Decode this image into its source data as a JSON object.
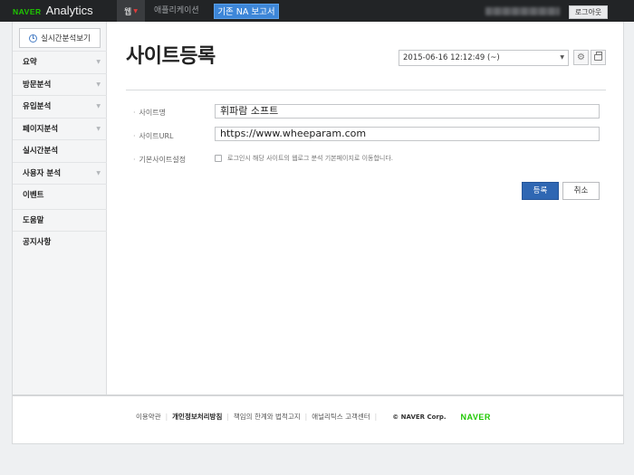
{
  "header": {
    "logo_naver": "NAVER",
    "logo_product": "Analytics",
    "nav_web": "웹",
    "nav_app": "애플리케이션",
    "nav_legacy": "기존 NA 보고서",
    "logout": "로그아웃",
    "brand_color": "#1ec800",
    "accent_color": "#3d86d8"
  },
  "sidebar": {
    "realtime_label": "실시간분석보기",
    "items": [
      {
        "label": "요약",
        "has_arrow": true
      },
      {
        "label": "방문분석",
        "has_arrow": true
      },
      {
        "label": "유입분석",
        "has_arrow": true
      },
      {
        "label": "페이지분석",
        "has_arrow": true
      },
      {
        "label": "실시간분석",
        "has_arrow": false
      },
      {
        "label": "사용자 분석",
        "has_arrow": true
      },
      {
        "label": "이벤트",
        "has_arrow": false
      },
      {
        "label": "도움말",
        "has_arrow": false
      },
      {
        "label": "공지사항",
        "has_arrow": false
      }
    ]
  },
  "main": {
    "title": "사이트등록",
    "date_value": "2015-06-16 12:12:49 (~)",
    "form": {
      "site_name_label": "사이트명",
      "site_name_value": "휘파람 소프트",
      "site_url_label": "사이트URL",
      "site_url_value": "https://www.wheeparam.com",
      "default_site_label": "기본사이트설정",
      "default_site_checkbox_text": "로그인시 해당 사이트의 웹로그 분석 기본페이지로 이동합니다.",
      "default_site_checked": false
    },
    "buttons": {
      "register": "등록",
      "cancel": "취소"
    }
  },
  "footer": {
    "terms": "이용약관",
    "privacy": "개인정보처리방침",
    "disclaimer": "책임의 한계와 법적고지",
    "support": "애널리틱스 고객센터",
    "copyright": "© NAVER Corp.",
    "naver_logo": "NAVER"
  }
}
